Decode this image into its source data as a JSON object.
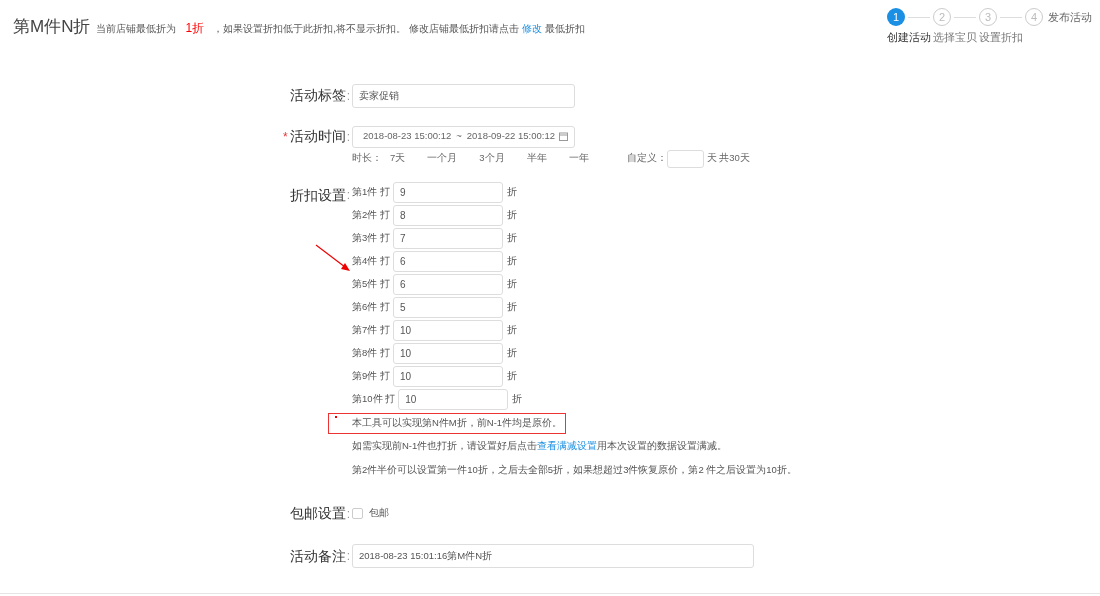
{
  "title": "第M件N折",
  "notice": {
    "prefix": "当前店铺最低折为",
    "highlight": "1折",
    "middle": "，如果设置折扣低于此折扣,将不显示折扣。 修改店铺最低折扣请点击",
    "link": "修改",
    "suffix": "最低折扣"
  },
  "steps": [
    {
      "number": "1",
      "label": "创建活动",
      "selected": true
    },
    {
      "number": "2",
      "label": "选择宝贝",
      "selected": false
    },
    {
      "number": "3",
      "label": "设置折扣",
      "selected": false
    },
    {
      "number": "4",
      "label": "发布活动",
      "selected": false
    }
  ],
  "tag_field": {
    "label": "活动标签",
    "colon": ":",
    "value": "卖家促销"
  },
  "time_field": {
    "label": "活动时间",
    "colon": ":",
    "required_mark": "*",
    "start": "2018-08-23 15:00:12",
    "separator": "~",
    "end": "2018-09-22 15:00:12"
  },
  "duration": {
    "label": "时长：",
    "options": [
      "7天",
      "一个月",
      "3个月",
      "半年",
      "一年"
    ],
    "custom_label": "自定义：",
    "custom_unit": "天 共30天"
  },
  "discount": {
    "label": "折扣设置",
    "colon": ":",
    "rows": [
      {
        "prefix": "第1件 打",
        "value": "9",
        "unit": "折"
      },
      {
        "prefix": "第2件 打",
        "value": "8",
        "unit": "折"
      },
      {
        "prefix": "第3件 打",
        "value": "7",
        "unit": "折"
      },
      {
        "prefix": "第4件 打",
        "value": "6",
        "unit": "折"
      },
      {
        "prefix": "第5件 打",
        "value": "6",
        "unit": "折"
      },
      {
        "prefix": "第6件 打",
        "value": "5",
        "unit": "折"
      },
      {
        "prefix": "第7件 打",
        "value": "10",
        "unit": "折"
      },
      {
        "prefix": "第8件 打",
        "value": "10",
        "unit": "折"
      },
      {
        "prefix": "第9件 打",
        "value": "10",
        "unit": "折"
      },
      {
        "prefix": "第10件 打",
        "value": "10",
        "unit": "折"
      }
    ],
    "notes": [
      {
        "kind": "boxed",
        "text": "本工具可以实现第N件M折，前N-1件均是原价。"
      },
      {
        "kind": "link",
        "before": "如需实现前N-1件也打折，请设置好后点击",
        "link": "查看满减设置",
        "after": "用本次设置的数据设置满减。"
      },
      {
        "kind": "plain",
        "text": "第2件半价可以设置第一件10折，之后去全部5折，如果想超过3件恢复原价，第2 件之后设置为10折。"
      }
    ]
  },
  "shipping": {
    "label": "包邮设置",
    "colon": ":",
    "option": "包邮",
    "checked": false
  },
  "remark": {
    "label": "活动备注",
    "colon": ":",
    "value": "2018-08-23 15:01:16第M件N折"
  }
}
